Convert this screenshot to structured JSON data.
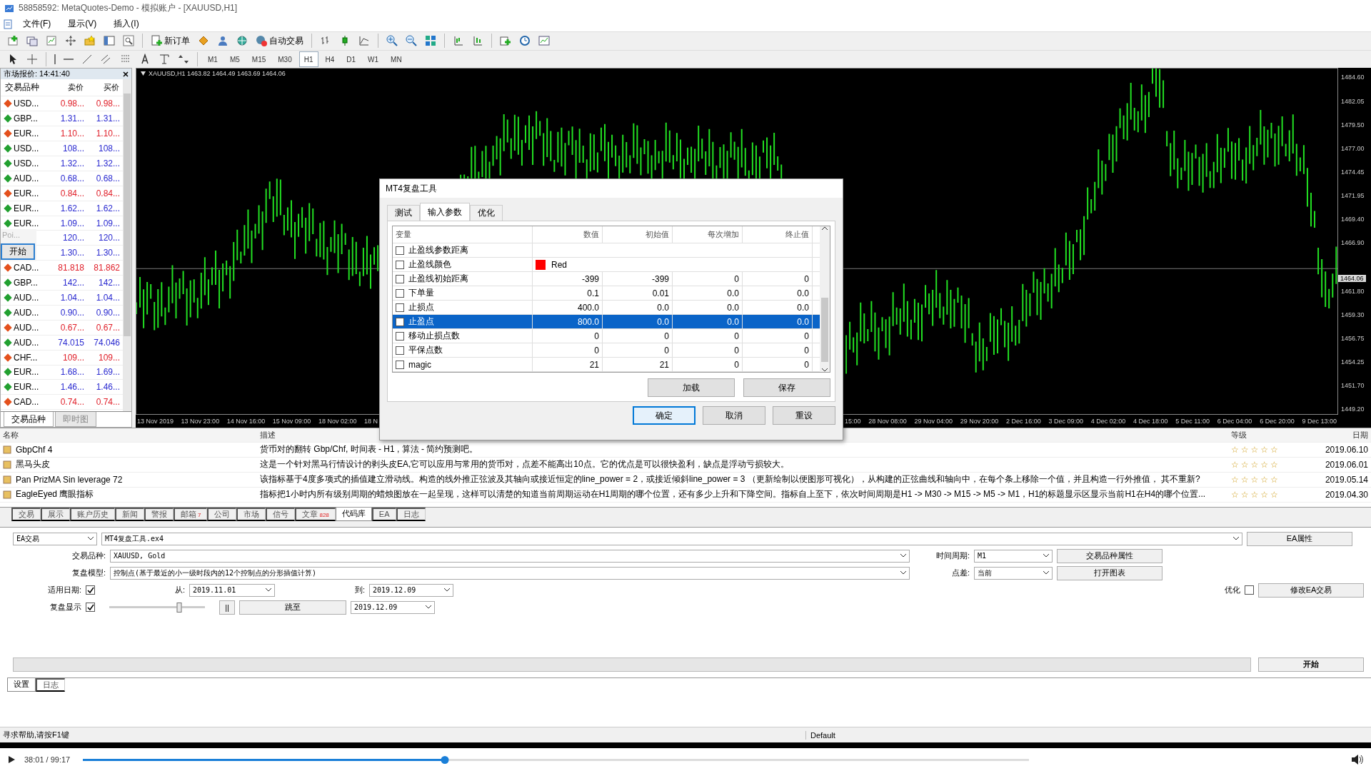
{
  "window": {
    "title": "58858592: MetaQuotes-Demo - 模拟账户 - [XAUUSD,H1]"
  },
  "menu": [
    "文件(F)",
    "显示(V)",
    "插入(I)"
  ],
  "toolbar": {
    "buttons": [
      {
        "kind": "new-order",
        "label": "新订单"
      },
      {
        "kind": "auto-trading",
        "label": "自动交易"
      }
    ],
    "timeframes": [
      {
        "label": "M1",
        "selected": false
      },
      {
        "label": "M5",
        "selected": false
      },
      {
        "label": "M15",
        "selected": false
      },
      {
        "label": "M30",
        "selected": false
      },
      {
        "label": "H1",
        "selected": true
      },
      {
        "label": "H4",
        "selected": false
      },
      {
        "label": "D1",
        "selected": false
      },
      {
        "label": "W1",
        "selected": false
      },
      {
        "label": "MN",
        "selected": false
      }
    ]
  },
  "market_watch": {
    "title": "市场报价: 14:41:40",
    "columns": [
      "交易品种",
      "卖价",
      "买价"
    ],
    "rows": [
      {
        "symbol": "USD...",
        "bid": "0.98...",
        "ask": "0.98...",
        "rising": false
      },
      {
        "symbol": "GBP...",
        "bid": "1.31...",
        "ask": "1.31...",
        "rising": true
      },
      {
        "symbol": "EUR...",
        "bid": "1.10...",
        "ask": "1.10...",
        "rising": false
      },
      {
        "symbol": "USD...",
        "bid": "108...",
        "ask": "108...",
        "rising": true
      },
      {
        "symbol": "USD...",
        "bid": "1.32...",
        "ask": "1.32...",
        "rising": true
      },
      {
        "symbol": "AUD...",
        "bid": "0.68...",
        "ask": "0.68...",
        "rising": true
      },
      {
        "symbol": "EUR...",
        "bid": "0.84...",
        "ask": "0.84...",
        "rising": false
      },
      {
        "symbol": "EUR...",
        "bid": "1.62...",
        "ask": "1.62...",
        "rising": true
      },
      {
        "symbol": "EUR...",
        "bid": "1.09...",
        "ask": "1.09...",
        "rising": true
      },
      {
        "bid": "120...",
        "ask": "120...",
        "rising": true
      },
      {
        "bid": "1.30...",
        "ask": "1.30...",
        "rising": true
      },
      {
        "symbol": "CAD...",
        "bid": "81.818",
        "ask": "81.862",
        "rising": false
      },
      {
        "symbol": "GBP...",
        "bid": "142...",
        "ask": "142...",
        "rising": true
      },
      {
        "symbol": "AUD...",
        "bid": "1.04...",
        "ask": "1.04...",
        "rising": true
      },
      {
        "symbol": "AUD...",
        "bid": "0.90...",
        "ask": "0.90...",
        "rising": true
      },
      {
        "symbol": "AUD...",
        "bid": "0.67...",
        "ask": "0.67...",
        "rising": false
      },
      {
        "symbol": "AUD...",
        "bid": "74.015",
        "ask": "74.046",
        "rising": true
      },
      {
        "symbol": "CHF...",
        "bid": "109...",
        "ask": "109...",
        "rising": false
      },
      {
        "symbol": "EUR...",
        "bid": "1.68...",
        "ask": "1.69...",
        "rising": true
      },
      {
        "symbol": "EUR...",
        "bid": "1.46...",
        "ask": "1.46...",
        "rising": true
      },
      {
        "symbol": "CAD...",
        "bid": "0.74...",
        "ask": "0.74...",
        "rising": false
      }
    ],
    "tabs": [
      {
        "label": "交易品种",
        "selected": true
      },
      {
        "label": "即时图",
        "selected": false
      }
    ],
    "popup": {
      "text": "Poi...",
      "button": "开始"
    }
  },
  "chart": {
    "header": "XAUUSD,H1 1463.82 1464.49 1463.69 1464.06",
    "y_labels": [
      "1484.60",
      "1482.05",
      "1479.50",
      "1477.00",
      "1474.45",
      "1471.95",
      "1469.40",
      "1466.90",
      "1461.80",
      "1459.30",
      "1456.75",
      "1454.25",
      "1451.70",
      "1449.20"
    ],
    "current_price": "1464.06",
    "x_labels_left": [
      "13 Nov 2019",
      "13 Nov 23:00",
      "14 Nov 16:00",
      "15 Nov 09:00",
      "18 Nov 02:00",
      "18 N"
    ],
    "x_labels_right": [
      "15:00",
      "28 Nov 08:00",
      "29 Nov 04:00",
      "29 Nov 20:00",
      "2 Dec 16:00",
      "3 Dec 09:00",
      "4 Dec 02:00",
      "4 Dec 18:00",
      "5 Dec 11:00",
      "6 Dec 04:00",
      "6 Dec 20:00",
      "9 Dec 13:00"
    ]
  },
  "dialog": {
    "title": "MT4复盘工具",
    "tabs": [
      {
        "label": "测试",
        "selected": false
      },
      {
        "label": "输入参数",
        "selected": true
      },
      {
        "label": "优化",
        "selected": false
      }
    ],
    "columns": [
      "变量",
      "数值",
      "初始值",
      "每次增加",
      "终止值"
    ],
    "rows": [
      {
        "kind": "group",
        "name": "止盈线参数距离",
        "checked": false,
        "selected": false
      },
      {
        "kind": "color",
        "name": "止盈线颜色",
        "checked": false,
        "selected": false,
        "value": "Red",
        "color": "#ff0000"
      },
      {
        "kind": "number",
        "name": "止盈线初始距离",
        "checked": false,
        "selected": false,
        "values": [
          "-399",
          "-399",
          "0",
          "0"
        ]
      },
      {
        "kind": "number",
        "name": "下单量",
        "checked": false,
        "selected": false,
        "values": [
          "0.1",
          "0.01",
          "0.0",
          "0.0"
        ]
      },
      {
        "kind": "number",
        "name": "止损点",
        "checked": false,
        "selected": false,
        "values": [
          "400.0",
          "0.0",
          "0.0",
          "0.0"
        ]
      },
      {
        "kind": "number",
        "name": "止盈点",
        "checked": false,
        "selected": true,
        "values": [
          "800.0",
          "0.0",
          "0.0",
          "0.0"
        ]
      },
      {
        "kind": "number",
        "name": "移动止损点数",
        "checked": false,
        "selected": false,
        "values": [
          "0",
          "0",
          "0",
          "0"
        ]
      },
      {
        "kind": "number",
        "name": "平保点数",
        "checked": false,
        "selected": false,
        "values": [
          "0",
          "0",
          "0",
          "0"
        ]
      },
      {
        "kind": "number",
        "name": "magic",
        "checked": false,
        "selected": false,
        "values": [
          "21",
          "21",
          "0",
          "0"
        ]
      }
    ],
    "load_button": "加载",
    "save_button": "保存",
    "buttons": [
      {
        "label": "确定",
        "focused": true
      },
      {
        "label": "取消",
        "focused": false
      },
      {
        "label": "重设",
        "focused": false
      }
    ]
  },
  "codebase": {
    "columns": [
      "名称",
      "描述",
      "等级",
      "日期"
    ],
    "rows": [
      {
        "name": "GbpChf 4",
        "description": "货币对的翻转 Gbp/Chf, 时间表 - H1 , 算法 - 简约预测吧。",
        "stars": 0,
        "date": "2019.06.10"
      },
      {
        "name": "黑马头皮",
        "description": "这是一个针对黑马行情设计的剥头皮EA,它可以应用与常用的货币对，点差不能高出10点。它的优点是可以很快盈利，缺点是浮动亏损较大。",
        "stars": 0,
        "date": "2019.06.01"
      },
      {
        "name": "Pan PrizMA Sin leverage 72",
        "description": "该指标基于4度多项式的插值建立滑动线。构造的线外推正弦波及其轴向或接近恒定的line_power = 2，或接近倾斜line_power = 3 （更新绘制以便图形可视化），从构建的正弦曲线和轴向中，在每个条上移除一个值，并且构造一行外推值， 其不重新?",
        "stars": 0,
        "date": "2019.05.14"
      },
      {
        "name": "EagleEyed 鹰眼指标",
        "description": "指标把1小时内所有级别周期的蜡烛图放在一起呈现，这样可以清楚的知道当前周期运动在H1周期的哪个位置，还有多少上升和下降空间。指标自上至下，依次时间周期是H1 -> M30 -> M15 -> M5 -> M1，H1的标题显示区显示当前H1在H4的哪个位置...",
        "stars": 0,
        "date": "2019.04.30"
      }
    ],
    "tabs": [
      {
        "label": "交易",
        "selected": false
      },
      {
        "label": "展示",
        "selected": false
      },
      {
        "label": "账户历史",
        "selected": false
      },
      {
        "label": "新闻",
        "selected": false
      },
      {
        "label": "警报",
        "selected": false
      },
      {
        "label": "邮箱",
        "badge": "7",
        "selected": false
      },
      {
        "label": "公司",
        "selected": false
      },
      {
        "label": "市场",
        "selected": false
      },
      {
        "label": "信号",
        "selected": false
      },
      {
        "label": "文章",
        "badge": "828",
        "selected": false
      },
      {
        "label": "代码库",
        "selected": true
      },
      {
        "label": "EA",
        "selected": false
      },
      {
        "label": "日志",
        "selected": false
      }
    ]
  },
  "tester": {
    "type": "EA交易",
    "expert": "MT4复盘工具.ex4",
    "expert_button": "EA属性",
    "symbol_label": "交易品种:",
    "symbol": "XAUUSD, Gold",
    "period_label": "时间周期:",
    "period": "M1",
    "symbol_button": "交易品种属性",
    "model_label": "复盘模型:",
    "model": "控制点(基于最近的小一级时段内的12个控制点的分形插值计算)",
    "spread_label": "点差:",
    "spread": "当前",
    "chart_button": "打开图表",
    "use_date_label": "适用日期:",
    "use_date": true,
    "from_label": "从:",
    "from": "2019.11.01",
    "to_label": "到:",
    "to": "2019.12.09",
    "optimize_label": "优化",
    "optimize": false,
    "modify_button": "修改EA交易",
    "visual_label": "复盘显示",
    "visual": true,
    "speed": {
      "level": 0.73
    },
    "pause_button": "||",
    "skip_button": "跳至",
    "skip_date": "2019.12.09",
    "progress": {
      "level": 0
    },
    "start_button": "开始",
    "tabs": [
      {
        "label": "设置",
        "selected": true
      },
      {
        "label": "日志",
        "selected": false
      }
    ]
  },
  "status_bar": {
    "help": "寻求帮助,请按F1键",
    "profile": "Default"
  },
  "player": {
    "time": "38:01 / 99:17",
    "level": 0.383
  }
}
